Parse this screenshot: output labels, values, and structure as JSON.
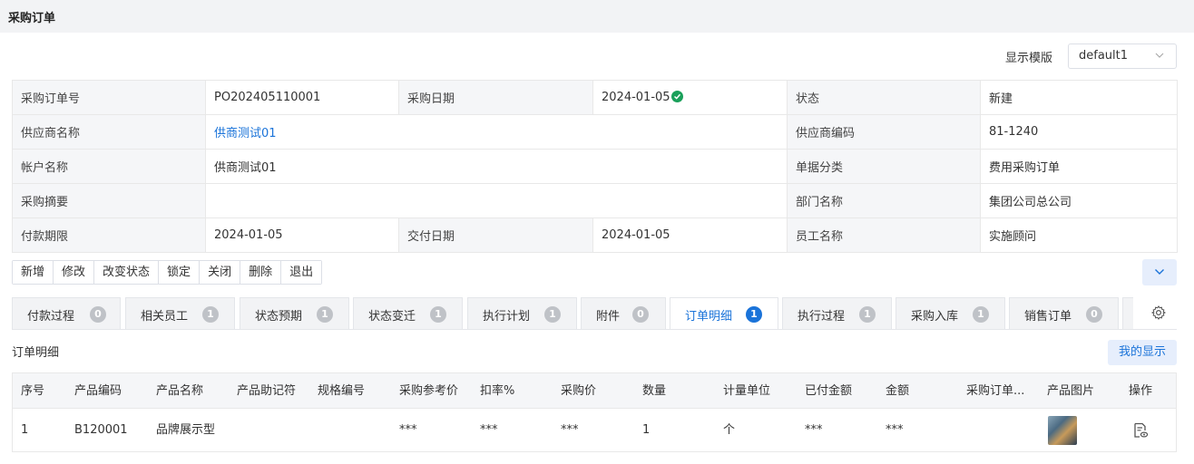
{
  "page": {
    "title": "采购订单"
  },
  "template": {
    "label": "显示模版",
    "selected": "default1"
  },
  "info": {
    "rows": [
      [
        {
          "label": "采购订单号",
          "value": "PO202405110001"
        },
        {
          "label": "采购日期",
          "value": "2024-01-05"
        },
        {
          "label": "状态",
          "value": "新建"
        }
      ],
      [
        {
          "label": "供应商名称",
          "value": "供商测试01"
        },
        {
          "label": "供应商编码",
          "value": "81-1240"
        }
      ],
      [
        {
          "label": "帐户名称",
          "value": "供商测试01"
        },
        {
          "label": "单据分类",
          "value": "费用采购订单"
        }
      ],
      [
        {
          "label": "采购摘要",
          "value": ""
        },
        {
          "label": "部门名称",
          "value": "集团公司总公司"
        }
      ],
      [
        {
          "label": "付款期限",
          "value": "2024-01-05"
        },
        {
          "label": "交付日期",
          "value": "2024-01-05"
        },
        {
          "label": "员工名称",
          "value": "实施顾问"
        }
      ]
    ]
  },
  "toolbar": {
    "buttons": [
      "新增",
      "修改",
      "改变状态",
      "锁定",
      "关闭",
      "删除",
      "退出"
    ]
  },
  "tabs": [
    {
      "label": "付款过程",
      "count": "0"
    },
    {
      "label": "相关员工",
      "count": "1"
    },
    {
      "label": "状态预期",
      "count": "1"
    },
    {
      "label": "状态变迁",
      "count": "1"
    },
    {
      "label": "执行计划",
      "count": "1"
    },
    {
      "label": "附件",
      "count": "0"
    },
    {
      "label": "订单明细",
      "count": "1",
      "active": true
    },
    {
      "label": "执行过程",
      "count": "1"
    },
    {
      "label": "采购入库",
      "count": "1"
    },
    {
      "label": "销售订单",
      "count": "0"
    }
  ],
  "detail": {
    "title": "订单明细",
    "my_display": "我的显示",
    "columns": [
      "序号",
      "产品编码",
      "产品名称",
      "产品助记符",
      "规格编号",
      "采购参考价",
      "扣率%",
      "采购价",
      "数量",
      "计量单位",
      "已付金额",
      "金额",
      "采购订单...",
      "产品图片",
      "操作"
    ],
    "rows": [
      [
        "1",
        "B120001",
        "品牌展示型",
        "",
        "",
        "***",
        "***",
        "***",
        "1",
        "个",
        "***",
        "***",
        "",
        "",
        ""
      ]
    ]
  },
  "colors": {
    "accent": "#1a73d9",
    "success": "#1aa05a",
    "label_bg": "#f5f6f8"
  },
  "icons": {
    "status_ok": "check-circle-icon",
    "settings": "gear-icon",
    "expand": "chevron-down-icon",
    "view": "view-document-icon",
    "product": "product-thumbnail"
  }
}
